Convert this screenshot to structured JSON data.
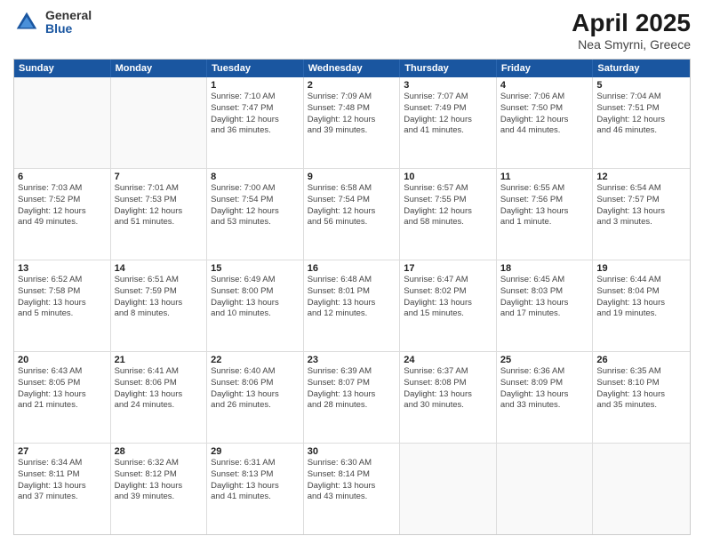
{
  "logo": {
    "general": "General",
    "blue": "Blue"
  },
  "title": "April 2025",
  "subtitle": "Nea Smyrni, Greece",
  "days_of_week": [
    "Sunday",
    "Monday",
    "Tuesday",
    "Wednesday",
    "Thursday",
    "Friday",
    "Saturday"
  ],
  "weeks": [
    [
      {
        "day": "",
        "info": ""
      },
      {
        "day": "",
        "info": ""
      },
      {
        "day": "1",
        "info": "Sunrise: 7:10 AM\nSunset: 7:47 PM\nDaylight: 12 hours\nand 36 minutes."
      },
      {
        "day": "2",
        "info": "Sunrise: 7:09 AM\nSunset: 7:48 PM\nDaylight: 12 hours\nand 39 minutes."
      },
      {
        "day": "3",
        "info": "Sunrise: 7:07 AM\nSunset: 7:49 PM\nDaylight: 12 hours\nand 41 minutes."
      },
      {
        "day": "4",
        "info": "Sunrise: 7:06 AM\nSunset: 7:50 PM\nDaylight: 12 hours\nand 44 minutes."
      },
      {
        "day": "5",
        "info": "Sunrise: 7:04 AM\nSunset: 7:51 PM\nDaylight: 12 hours\nand 46 minutes."
      }
    ],
    [
      {
        "day": "6",
        "info": "Sunrise: 7:03 AM\nSunset: 7:52 PM\nDaylight: 12 hours\nand 49 minutes."
      },
      {
        "day": "7",
        "info": "Sunrise: 7:01 AM\nSunset: 7:53 PM\nDaylight: 12 hours\nand 51 minutes."
      },
      {
        "day": "8",
        "info": "Sunrise: 7:00 AM\nSunset: 7:54 PM\nDaylight: 12 hours\nand 53 minutes."
      },
      {
        "day": "9",
        "info": "Sunrise: 6:58 AM\nSunset: 7:54 PM\nDaylight: 12 hours\nand 56 minutes."
      },
      {
        "day": "10",
        "info": "Sunrise: 6:57 AM\nSunset: 7:55 PM\nDaylight: 12 hours\nand 58 minutes."
      },
      {
        "day": "11",
        "info": "Sunrise: 6:55 AM\nSunset: 7:56 PM\nDaylight: 13 hours\nand 1 minute."
      },
      {
        "day": "12",
        "info": "Sunrise: 6:54 AM\nSunset: 7:57 PM\nDaylight: 13 hours\nand 3 minutes."
      }
    ],
    [
      {
        "day": "13",
        "info": "Sunrise: 6:52 AM\nSunset: 7:58 PM\nDaylight: 13 hours\nand 5 minutes."
      },
      {
        "day": "14",
        "info": "Sunrise: 6:51 AM\nSunset: 7:59 PM\nDaylight: 13 hours\nand 8 minutes."
      },
      {
        "day": "15",
        "info": "Sunrise: 6:49 AM\nSunset: 8:00 PM\nDaylight: 13 hours\nand 10 minutes."
      },
      {
        "day": "16",
        "info": "Sunrise: 6:48 AM\nSunset: 8:01 PM\nDaylight: 13 hours\nand 12 minutes."
      },
      {
        "day": "17",
        "info": "Sunrise: 6:47 AM\nSunset: 8:02 PM\nDaylight: 13 hours\nand 15 minutes."
      },
      {
        "day": "18",
        "info": "Sunrise: 6:45 AM\nSunset: 8:03 PM\nDaylight: 13 hours\nand 17 minutes."
      },
      {
        "day": "19",
        "info": "Sunrise: 6:44 AM\nSunset: 8:04 PM\nDaylight: 13 hours\nand 19 minutes."
      }
    ],
    [
      {
        "day": "20",
        "info": "Sunrise: 6:43 AM\nSunset: 8:05 PM\nDaylight: 13 hours\nand 21 minutes."
      },
      {
        "day": "21",
        "info": "Sunrise: 6:41 AM\nSunset: 8:06 PM\nDaylight: 13 hours\nand 24 minutes."
      },
      {
        "day": "22",
        "info": "Sunrise: 6:40 AM\nSunset: 8:06 PM\nDaylight: 13 hours\nand 26 minutes."
      },
      {
        "day": "23",
        "info": "Sunrise: 6:39 AM\nSunset: 8:07 PM\nDaylight: 13 hours\nand 28 minutes."
      },
      {
        "day": "24",
        "info": "Sunrise: 6:37 AM\nSunset: 8:08 PM\nDaylight: 13 hours\nand 30 minutes."
      },
      {
        "day": "25",
        "info": "Sunrise: 6:36 AM\nSunset: 8:09 PM\nDaylight: 13 hours\nand 33 minutes."
      },
      {
        "day": "26",
        "info": "Sunrise: 6:35 AM\nSunset: 8:10 PM\nDaylight: 13 hours\nand 35 minutes."
      }
    ],
    [
      {
        "day": "27",
        "info": "Sunrise: 6:34 AM\nSunset: 8:11 PM\nDaylight: 13 hours\nand 37 minutes."
      },
      {
        "day": "28",
        "info": "Sunrise: 6:32 AM\nSunset: 8:12 PM\nDaylight: 13 hours\nand 39 minutes."
      },
      {
        "day": "29",
        "info": "Sunrise: 6:31 AM\nSunset: 8:13 PM\nDaylight: 13 hours\nand 41 minutes."
      },
      {
        "day": "30",
        "info": "Sunrise: 6:30 AM\nSunset: 8:14 PM\nDaylight: 13 hours\nand 43 minutes."
      },
      {
        "day": "",
        "info": ""
      },
      {
        "day": "",
        "info": ""
      },
      {
        "day": "",
        "info": ""
      }
    ]
  ]
}
